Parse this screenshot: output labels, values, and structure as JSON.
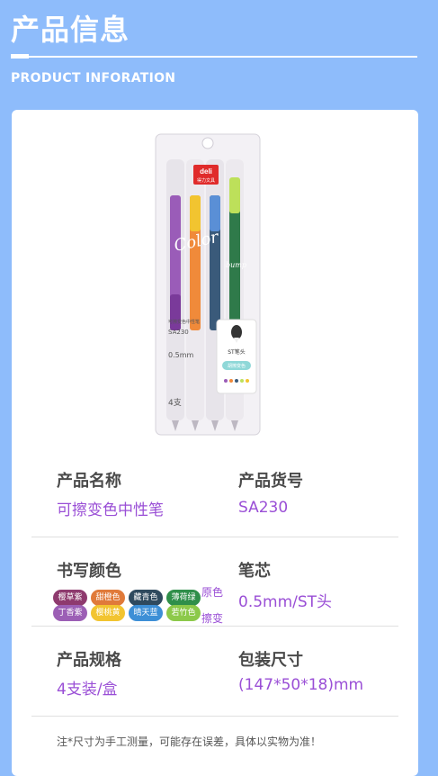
{
  "header": {
    "title": "产品信息",
    "subtitle": "PRODUCT INFORATION"
  },
  "product_image": {
    "brand": "deli",
    "brand_cn": "得力文具",
    "script_text": "Color",
    "script_sub": "bump",
    "pack_name": "可擦变色中性笔",
    "pack_code": "SA230",
    "pack_size": "0.5mm",
    "pack_count": "4支",
    "tag_tip": "ST笔头",
    "tag_feature": "胡擦变色"
  },
  "specs": {
    "name_label": "产品名称",
    "name_value": "可擦变色中性笔",
    "code_label": "产品货号",
    "code_value": "SA230",
    "color_label": "书写颜色",
    "refill_label": "笔芯",
    "refill_value": "0.5mm/ST头",
    "spec_label": "产品规格",
    "spec_value": "4支装/盒",
    "pack_label": "包装尺寸",
    "pack_value": "(147*50*18)mm"
  },
  "ink_colors": {
    "chips": [
      {
        "top": "樱草紫",
        "bottom": "丁香紫",
        "top_color": "#8e3a6e",
        "bottom_color": "#9c5fb5"
      },
      {
        "top": "甜橙色",
        "bottom": "樱桃黄",
        "top_color": "#e07a3a",
        "bottom_color": "#f2c430"
      },
      {
        "top": "藏青色",
        "bottom": "晴天蓝",
        "top_color": "#2f4a5e",
        "bottom_color": "#3d8fd6"
      },
      {
        "top": "薄荷绿",
        "bottom": "若竹色",
        "top_color": "#2f8f4a",
        "bottom_color": "#8cc94a"
      }
    ],
    "original_label": "原色",
    "erase_label": "擦变"
  },
  "note": "注*尺寸为手工测量，可能存在误差，具体以实物为准！"
}
